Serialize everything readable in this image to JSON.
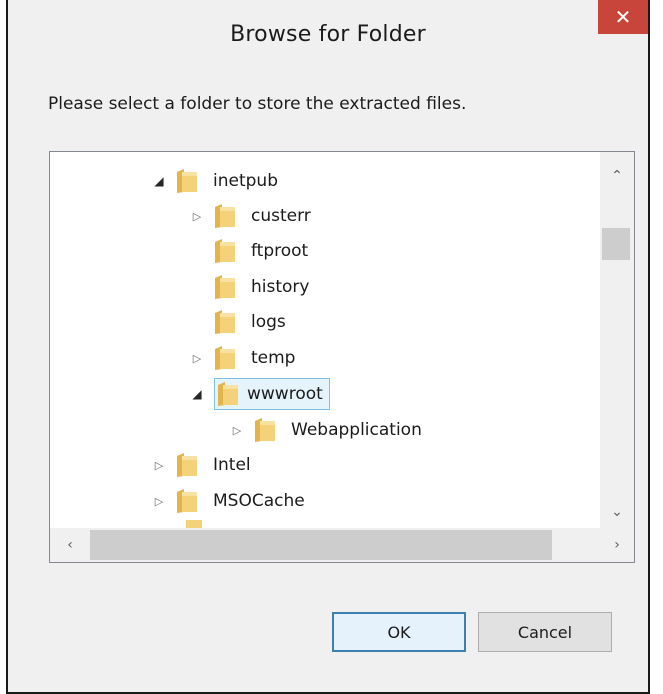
{
  "dialog": {
    "title": "Browse for Folder",
    "close_glyph": "✕",
    "prompt": "Please select a folder to store the extracted files."
  },
  "tree": {
    "selected": "wwwroot",
    "items": [
      {
        "label": "inetpub",
        "expander": "expanded"
      },
      {
        "label": "custerr",
        "expander": "collapsed"
      },
      {
        "label": "ftproot",
        "expander": "none"
      },
      {
        "label": "history",
        "expander": "none"
      },
      {
        "label": "logs",
        "expander": "none"
      },
      {
        "label": "temp",
        "expander": "collapsed"
      },
      {
        "label": "wwwroot",
        "expander": "expanded"
      },
      {
        "label": "Webapplication",
        "expander": "collapsed"
      },
      {
        "label": "Intel",
        "expander": "collapsed"
      },
      {
        "label": "MSOCache",
        "expander": "collapsed"
      }
    ]
  },
  "scrollbar": {
    "up_glyph": "⌃",
    "down_glyph": "⌄",
    "left_glyph": "‹",
    "right_glyph": "›"
  },
  "buttons": {
    "ok": "OK",
    "cancel": "Cancel"
  },
  "colors": {
    "close_button": "#c7453a",
    "selection_fill": "#e5f3fb",
    "selection_border": "#7dc1e8",
    "default_button_border": "#3c7fb1",
    "folder_yellow": "#f4d27a"
  },
  "icons": {
    "folder": "folder-icon",
    "expanded": "triangle-expanded-icon",
    "collapsed": "triangle-collapsed-icon"
  }
}
